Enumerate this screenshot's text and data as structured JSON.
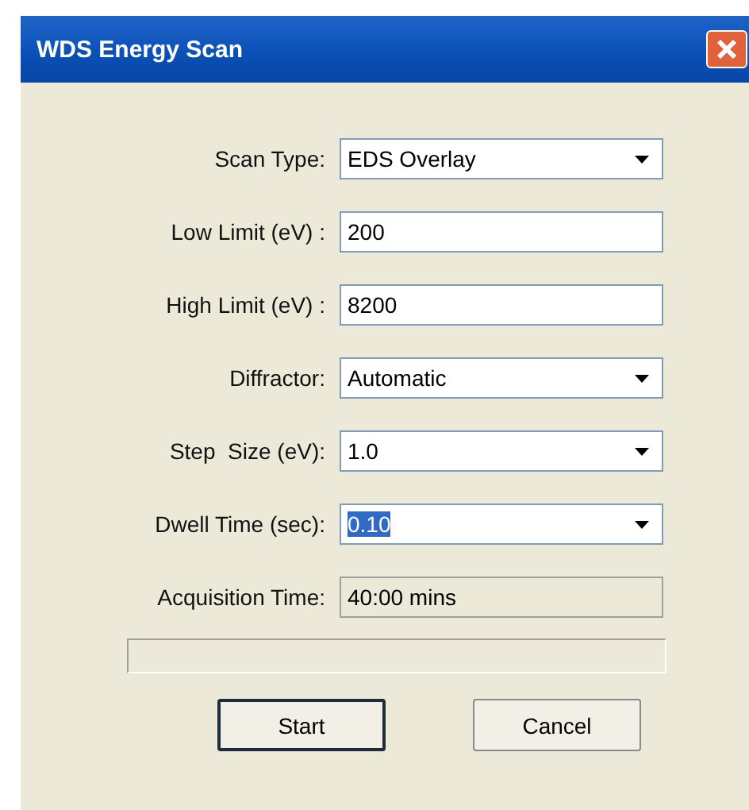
{
  "window": {
    "title": "WDS Energy Scan"
  },
  "fields": [
    {
      "kind": "dropdown",
      "label": "Scan Type:",
      "value": "EDS Overlay",
      "selected": false
    },
    {
      "kind": "text",
      "label": "Low Limit (eV) :",
      "value": "200",
      "selected": false
    },
    {
      "kind": "text",
      "label": "High Limit (eV) :",
      "value": "8200",
      "selected": false
    },
    {
      "kind": "dropdown",
      "label": "Diffractor:",
      "value": "Automatic",
      "selected": false
    },
    {
      "kind": "dropdown",
      "label": "Step  Size (eV):",
      "value": "1.0",
      "selected": false
    },
    {
      "kind": "dropdown",
      "label": "Dwell Time (sec):",
      "value": "0.10",
      "selected": true
    },
    {
      "kind": "readonly",
      "label": "Acquisition Time:",
      "value": "40:00 mins",
      "selected": false
    }
  ],
  "progress_bar": {
    "level": 0
  },
  "buttons": [
    {
      "label": "Start",
      "default": true
    },
    {
      "label": "Cancel",
      "default": false
    }
  ]
}
